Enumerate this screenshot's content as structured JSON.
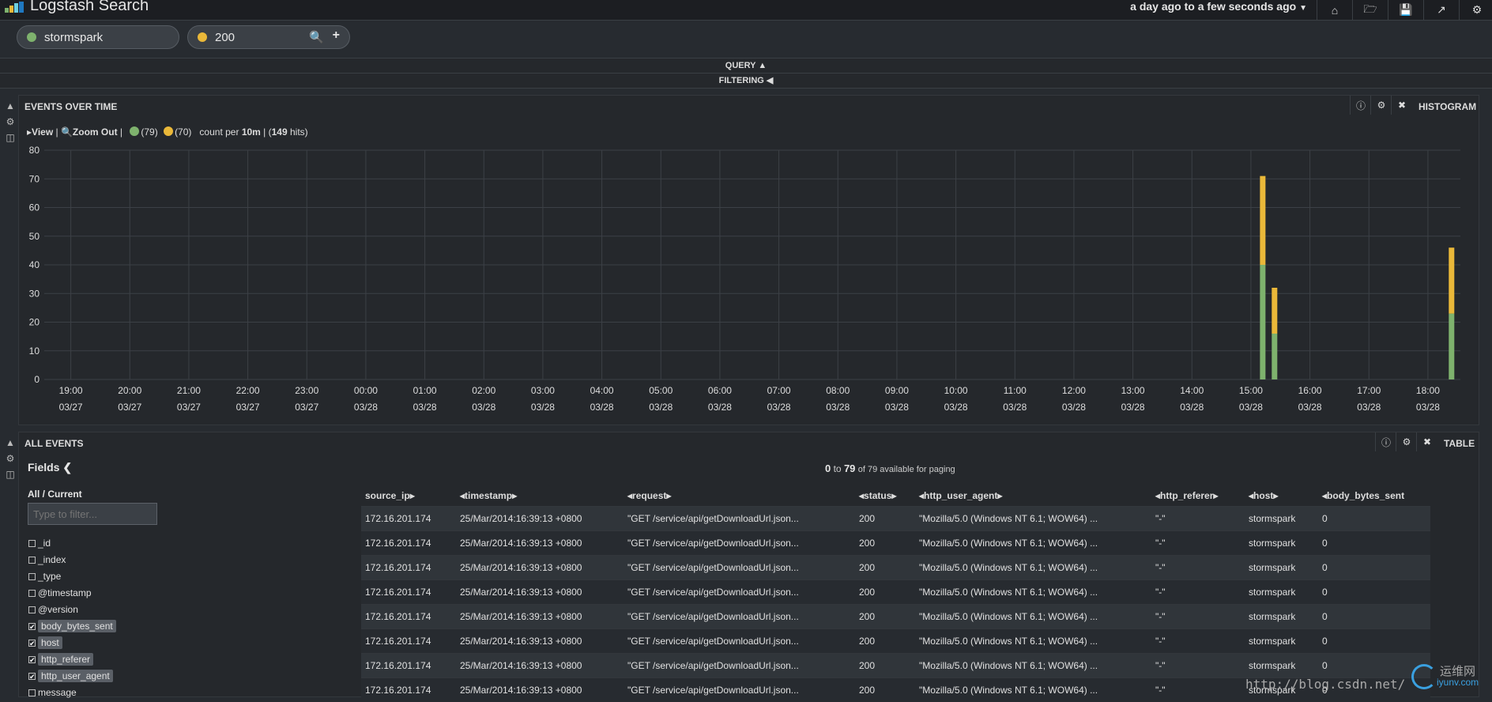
{
  "app": {
    "title": "Logstash Search",
    "time_range": "a day ago to a few seconds ago"
  },
  "nav_icons": [
    "home-icon",
    "folder-open-icon",
    "save-icon",
    "share-icon",
    "gear-icon"
  ],
  "queries": [
    {
      "label": "stormspark",
      "color": "#7eb26d"
    },
    {
      "label": "200",
      "color": "#eab839"
    }
  ],
  "strips": {
    "query": "QUERY",
    "filtering": "FILTERING"
  },
  "histogram_panel": {
    "title": "EVENTS OVER TIME",
    "type_label": "HISTOGRAM",
    "view_label": "View",
    "zoom_label": "Zoom Out",
    "legend": [
      {
        "count": "(79)",
        "color": "#7eb26d"
      },
      {
        "count": "(70)",
        "color": "#eab839"
      }
    ],
    "count_per_prefix": "count per",
    "interval": "10m",
    "hits": "149",
    "hits_suffix": "hits)"
  },
  "chart_data": {
    "type": "bar",
    "stacked": true,
    "x_ticks": [
      {
        "time": "19:00",
        "date": "03/27"
      },
      {
        "time": "20:00",
        "date": "03/27"
      },
      {
        "time": "21:00",
        "date": "03/27"
      },
      {
        "time": "22:00",
        "date": "03/27"
      },
      {
        "time": "23:00",
        "date": "03/27"
      },
      {
        "time": "00:00",
        "date": "03/28"
      },
      {
        "time": "01:00",
        "date": "03/28"
      },
      {
        "time": "02:00",
        "date": "03/28"
      },
      {
        "time": "03:00",
        "date": "03/28"
      },
      {
        "time": "04:00",
        "date": "03/28"
      },
      {
        "time": "05:00",
        "date": "03/28"
      },
      {
        "time": "06:00",
        "date": "03/28"
      },
      {
        "time": "07:00",
        "date": "03/28"
      },
      {
        "time": "08:00",
        "date": "03/28"
      },
      {
        "time": "09:00",
        "date": "03/28"
      },
      {
        "time": "10:00",
        "date": "03/28"
      },
      {
        "time": "11:00",
        "date": "03/28"
      },
      {
        "time": "12:00",
        "date": "03/28"
      },
      {
        "time": "13:00",
        "date": "03/28"
      },
      {
        "time": "14:00",
        "date": "03/28"
      },
      {
        "time": "15:00",
        "date": "03/28"
      },
      {
        "time": "16:00",
        "date": "03/28"
      },
      {
        "time": "17:00",
        "date": "03/28"
      },
      {
        "time": "18:00",
        "date": "03/28"
      }
    ],
    "y_ticks": [
      0,
      10,
      20,
      30,
      40,
      50,
      60,
      70,
      80
    ],
    "ylim": [
      0,
      80
    ],
    "x_range_hours": [
      18.55,
      42.55
    ],
    "grid": true,
    "series": [
      {
        "color": "#7eb26d",
        "bars": [
          {
            "t": 39.2,
            "value": 40
          },
          {
            "t": 39.4,
            "value": 16
          },
          {
            "t": 42.4,
            "value": 23
          }
        ]
      },
      {
        "color": "#eab839",
        "bars": [
          {
            "t": 39.2,
            "value": 31
          },
          {
            "t": 39.4,
            "value": 16
          },
          {
            "t": 42.4,
            "value": 23
          }
        ]
      }
    ]
  },
  "events_panel": {
    "title": "ALL EVENTS",
    "type_label": "TABLE",
    "fields_label": "Fields",
    "all_current": "All / Current",
    "filter_placeholder": "Type to filter...",
    "paging_from": "0",
    "paging_to_word": "to",
    "paging_to": "79",
    "paging_suffix": "of 79 available for paging"
  },
  "fields": [
    {
      "name": "_id",
      "checked": false
    },
    {
      "name": "_index",
      "checked": false
    },
    {
      "name": "_type",
      "checked": false
    },
    {
      "name": "@timestamp",
      "checked": false
    },
    {
      "name": "@version",
      "checked": false
    },
    {
      "name": "body_bytes_sent",
      "checked": true
    },
    {
      "name": "host",
      "checked": true
    },
    {
      "name": "http_referer",
      "checked": true
    },
    {
      "name": "http_user_agent",
      "checked": true
    },
    {
      "name": "message",
      "checked": false
    }
  ],
  "table": {
    "columns": [
      "source_ip",
      "timestamp",
      "request",
      "status",
      "http_user_agent",
      "http_referer",
      "host",
      "body_bytes_sent"
    ],
    "rows": [
      [
        "172.16.201.174",
        "25/Mar/2014:16:39:13 +0800",
        "\"GET /service/api/getDownloadUrl.json...",
        "200",
        "\"Mozilla/5.0 (Windows NT 6.1; WOW64) ...",
        "\"-\"",
        "stormspark",
        "0"
      ],
      [
        "172.16.201.174",
        "25/Mar/2014:16:39:13 +0800",
        "\"GET /service/api/getDownloadUrl.json...",
        "200",
        "\"Mozilla/5.0 (Windows NT 6.1; WOW64) ...",
        "\"-\"",
        "stormspark",
        "0"
      ],
      [
        "172.16.201.174",
        "25/Mar/2014:16:39:13 +0800",
        "\"GET /service/api/getDownloadUrl.json...",
        "200",
        "\"Mozilla/5.0 (Windows NT 6.1; WOW64) ...",
        "\"-\"",
        "stormspark",
        "0"
      ],
      [
        "172.16.201.174",
        "25/Mar/2014:16:39:13 +0800",
        "\"GET /service/api/getDownloadUrl.json...",
        "200",
        "\"Mozilla/5.0 (Windows NT 6.1; WOW64) ...",
        "\"-\"",
        "stormspark",
        "0"
      ],
      [
        "172.16.201.174",
        "25/Mar/2014:16:39:13 +0800",
        "\"GET /service/api/getDownloadUrl.json...",
        "200",
        "\"Mozilla/5.0 (Windows NT 6.1; WOW64) ...",
        "\"-\"",
        "stormspark",
        "0"
      ],
      [
        "172.16.201.174",
        "25/Mar/2014:16:39:13 +0800",
        "\"GET /service/api/getDownloadUrl.json...",
        "200",
        "\"Mozilla/5.0 (Windows NT 6.1; WOW64) ...",
        "\"-\"",
        "stormspark",
        "0"
      ],
      [
        "172.16.201.174",
        "25/Mar/2014:16:39:13 +0800",
        "\"GET /service/api/getDownloadUrl.json...",
        "200",
        "\"Mozilla/5.0 (Windows NT 6.1; WOW64) ...",
        "\"-\"",
        "stormspark",
        "0"
      ],
      [
        "172.16.201.174",
        "25/Mar/2014:16:39:13 +0800",
        "\"GET /service/api/getDownloadUrl.json...",
        "200",
        "\"Mozilla/5.0 (Windows NT 6.1; WOW64) ...",
        "\"-\"",
        "stormspark",
        "0"
      ]
    ]
  },
  "watermark": {
    "url": "http://blog.csdn.net/",
    "brand": "运维网",
    "brand_sub": "iyunv.com"
  }
}
